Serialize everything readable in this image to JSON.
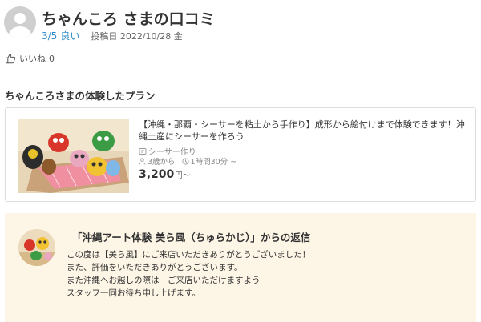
{
  "review": {
    "title": "ちゃんころ さまの口コミ",
    "score": "3/5",
    "rating_label": "良い",
    "post_date": "投稿日 2022/10/28 金"
  },
  "like": {
    "label": "いいね",
    "count": "0",
    "icon": "thumbs-up-icon"
  },
  "section": {
    "heading": "ちゃんころさまの体験したプラン"
  },
  "plan": {
    "title": "【沖縄・那覇・シーサーを粘土から手作り】成形から絵付けまで体験できます！沖縄土産にシーサーを作ろう",
    "tag": "シーサー作り",
    "age": "3歳から",
    "duration": "1時間30分 ~",
    "price": "3,200",
    "price_unit": "円～"
  },
  "reply": {
    "heading": "「沖縄アート体験 美ら風（ちゅらかじ）」からの返信",
    "lines": {
      "l1": "この度は【美ら風】にご来店いただきありがとうございました！",
      "l2": "また、評価をいただきありがとうございます。",
      "l3": "また沖縄へお越しの際は　ご来店いただけますよう",
      "l4": "スタッフ一同お待ち申し上げます。"
    }
  },
  "colors": {
    "accent_blue": "#2e8bc9",
    "reply_background": "#fdf5e6",
    "card_border": "#dddddd"
  }
}
